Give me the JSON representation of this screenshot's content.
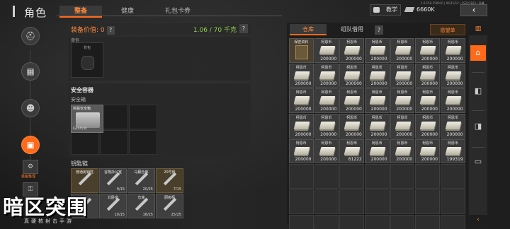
{
  "header": {
    "title": "角色",
    "tabs": [
      {
        "label": "整备",
        "active": true
      },
      {
        "label": "健康",
        "active": false
      },
      {
        "label": "礼包卡券",
        "active": false
      }
    ],
    "teach_label": "教学",
    "status_text": "1.0.150.150010 | 06/11/12 | 3S203183 | 高峰",
    "money": "6660K",
    "close_icon": "‹"
  },
  "left_rail": {
    "icons": [
      "helmet-icon",
      "vest-icon",
      "mask-icon",
      "backpack-icon"
    ],
    "label": "装备整理"
  },
  "equipment": {
    "value_label": "装备价值: 0",
    "help": "?",
    "weight": "1.06 / 70 千克"
  },
  "bag": {
    "header": "背包",
    "slot_label": "背包"
  },
  "safe": {
    "title": "安全容器",
    "sub": "安全箱",
    "item_name": "简易安全箱",
    "item_time": "6天14小时"
  },
  "keychain": {
    "title": "钥匙链",
    "keys": [
      {
        "name": "普通房钥匙",
        "count": "",
        "tone": "gold"
      },
      {
        "name": "谷物办公室",
        "count": "9/15",
        "tone": "gray"
      },
      {
        "name": "马厩仓库",
        "count": "20/25",
        "tone": "gray"
      },
      {
        "name": "20号房",
        "count": "7/15",
        "tone": "gold"
      },
      {
        "name": "",
        "count": "",
        "tone": "gray"
      },
      {
        "name": "北卧室",
        "count": "10/15",
        "tone": "gray"
      },
      {
        "name": "仓库",
        "count": "16/25",
        "tone": "gray"
      },
      {
        "name": "厨房柜",
        "count": "25/25",
        "tone": "gray"
      }
    ]
  },
  "logo": {
    "title": "暗区突围",
    "subtitle": "真硬核射击手游"
  },
  "warehouse": {
    "tabs": [
      {
        "label": "仓库",
        "active": true
      },
      {
        "label": "组队借用",
        "active": false
      }
    ],
    "help": "?",
    "wishlist": "愿望单",
    "items": [
      {
        "name": "保密资料",
        "count": "",
        "type": "doc"
      },
      {
        "name": "柯恩币",
        "count": "200000",
        "type": "money"
      },
      {
        "name": "柯恩币",
        "count": "200000",
        "type": "money"
      },
      {
        "name": "柯恩币",
        "count": "200000",
        "type": "money"
      },
      {
        "name": "柯恩币",
        "count": "200000",
        "type": "money"
      },
      {
        "name": "柯恩币",
        "count": "200000",
        "type": "money"
      },
      {
        "name": "柯恩币",
        "count": "200000",
        "type": "money"
      },
      {
        "name": "柯恩币",
        "count": "200000",
        "type": "money"
      },
      {
        "name": "柯恩币",
        "count": "200000",
        "type": "money"
      },
      {
        "name": "柯恩币",
        "count": "200000",
        "type": "money"
      },
      {
        "name": "柯恩币",
        "count": "200000",
        "type": "money"
      },
      {
        "name": "柯恩币",
        "count": "200000",
        "type": "money"
      },
      {
        "name": "柯恩币",
        "count": "200000",
        "type": "money"
      },
      {
        "name": "柯恩币",
        "count": "200000",
        "type": "money"
      },
      {
        "name": "柯恩币",
        "count": "200000",
        "type": "money"
      },
      {
        "name": "柯恩币",
        "count": "200000",
        "type": "money"
      },
      {
        "name": "柯恩币",
        "count": "200000",
        "type": "money"
      },
      {
        "name": "柯恩币",
        "count": "200000",
        "type": "money"
      },
      {
        "name": "柯恩币",
        "count": "200000",
        "type": "money"
      },
      {
        "name": "柯恩币",
        "count": "200000",
        "type": "money"
      },
      {
        "name": "柯恩币",
        "count": "200000",
        "type": "money"
      },
      {
        "name": "柯恩币",
        "count": "200000",
        "type": "money"
      },
      {
        "name": "柯恩币",
        "count": "200000",
        "type": "money"
      },
      {
        "name": "柯恩币",
        "count": "200000",
        "type": "money"
      },
      {
        "name": "柯恩币",
        "count": "200000",
        "type": "money"
      },
      {
        "name": "柯恩币",
        "count": "200000",
        "type": "money"
      },
      {
        "name": "柯恩币",
        "count": "200000",
        "type": "money"
      },
      {
        "name": "柯恩币",
        "count": "200000",
        "type": "money"
      },
      {
        "name": "柯恩币",
        "count": "200000",
        "type": "money"
      },
      {
        "name": "柯恩币",
        "count": "200000",
        "type": "money"
      },
      {
        "name": "柯恩币",
        "count": "61222",
        "type": "money"
      },
      {
        "name": "柯恩币",
        "count": "200000",
        "type": "money"
      },
      {
        "name": "柯恩币",
        "count": "200000",
        "type": "money"
      },
      {
        "name": "柯恩币",
        "count": "200000",
        "type": "money"
      },
      {
        "name": "柯恩币",
        "count": "199319",
        "type": "money"
      },
      {
        "name": "",
        "count": "",
        "type": "empty"
      },
      {
        "name": "",
        "count": "",
        "type": "empty"
      },
      {
        "name": "",
        "count": "",
        "type": "empty"
      },
      {
        "name": "",
        "count": "",
        "type": "empty"
      },
      {
        "name": "",
        "count": "",
        "type": "empty"
      },
      {
        "name": "",
        "count": "",
        "type": "empty"
      },
      {
        "name": "",
        "count": "",
        "type": "empty"
      },
      {
        "name": "",
        "count": "",
        "type": "empty"
      },
      {
        "name": "",
        "count": "",
        "type": "empty"
      },
      {
        "name": "",
        "count": "",
        "type": "empty"
      },
      {
        "name": "",
        "count": "",
        "type": "empty"
      },
      {
        "name": "",
        "count": "",
        "type": "empty"
      },
      {
        "name": "",
        "count": "",
        "type": "empty"
      },
      {
        "name": "",
        "count": "",
        "type": "empty"
      },
      {
        "name": "",
        "count": "",
        "type": "empty"
      },
      {
        "name": "",
        "count": "",
        "type": "empty"
      },
      {
        "name": "",
        "count": "",
        "type": "empty"
      },
      {
        "name": "",
        "count": "",
        "type": "empty"
      },
      {
        "name": "",
        "count": "",
        "type": "empty"
      },
      {
        "name": "",
        "count": "",
        "type": "empty"
      },
      {
        "name": "",
        "count": "",
        "type": "empty"
      }
    ]
  },
  "right_rail": {
    "top_icon": "grid-icon",
    "buttons": [
      "home-icon",
      "box-icon",
      "crate-icon",
      "wallet-icon"
    ],
    "bottom_icon": "‹"
  },
  "colors": {
    "accent": "#ff6a1a",
    "weight_ok": "#8fd14f"
  }
}
